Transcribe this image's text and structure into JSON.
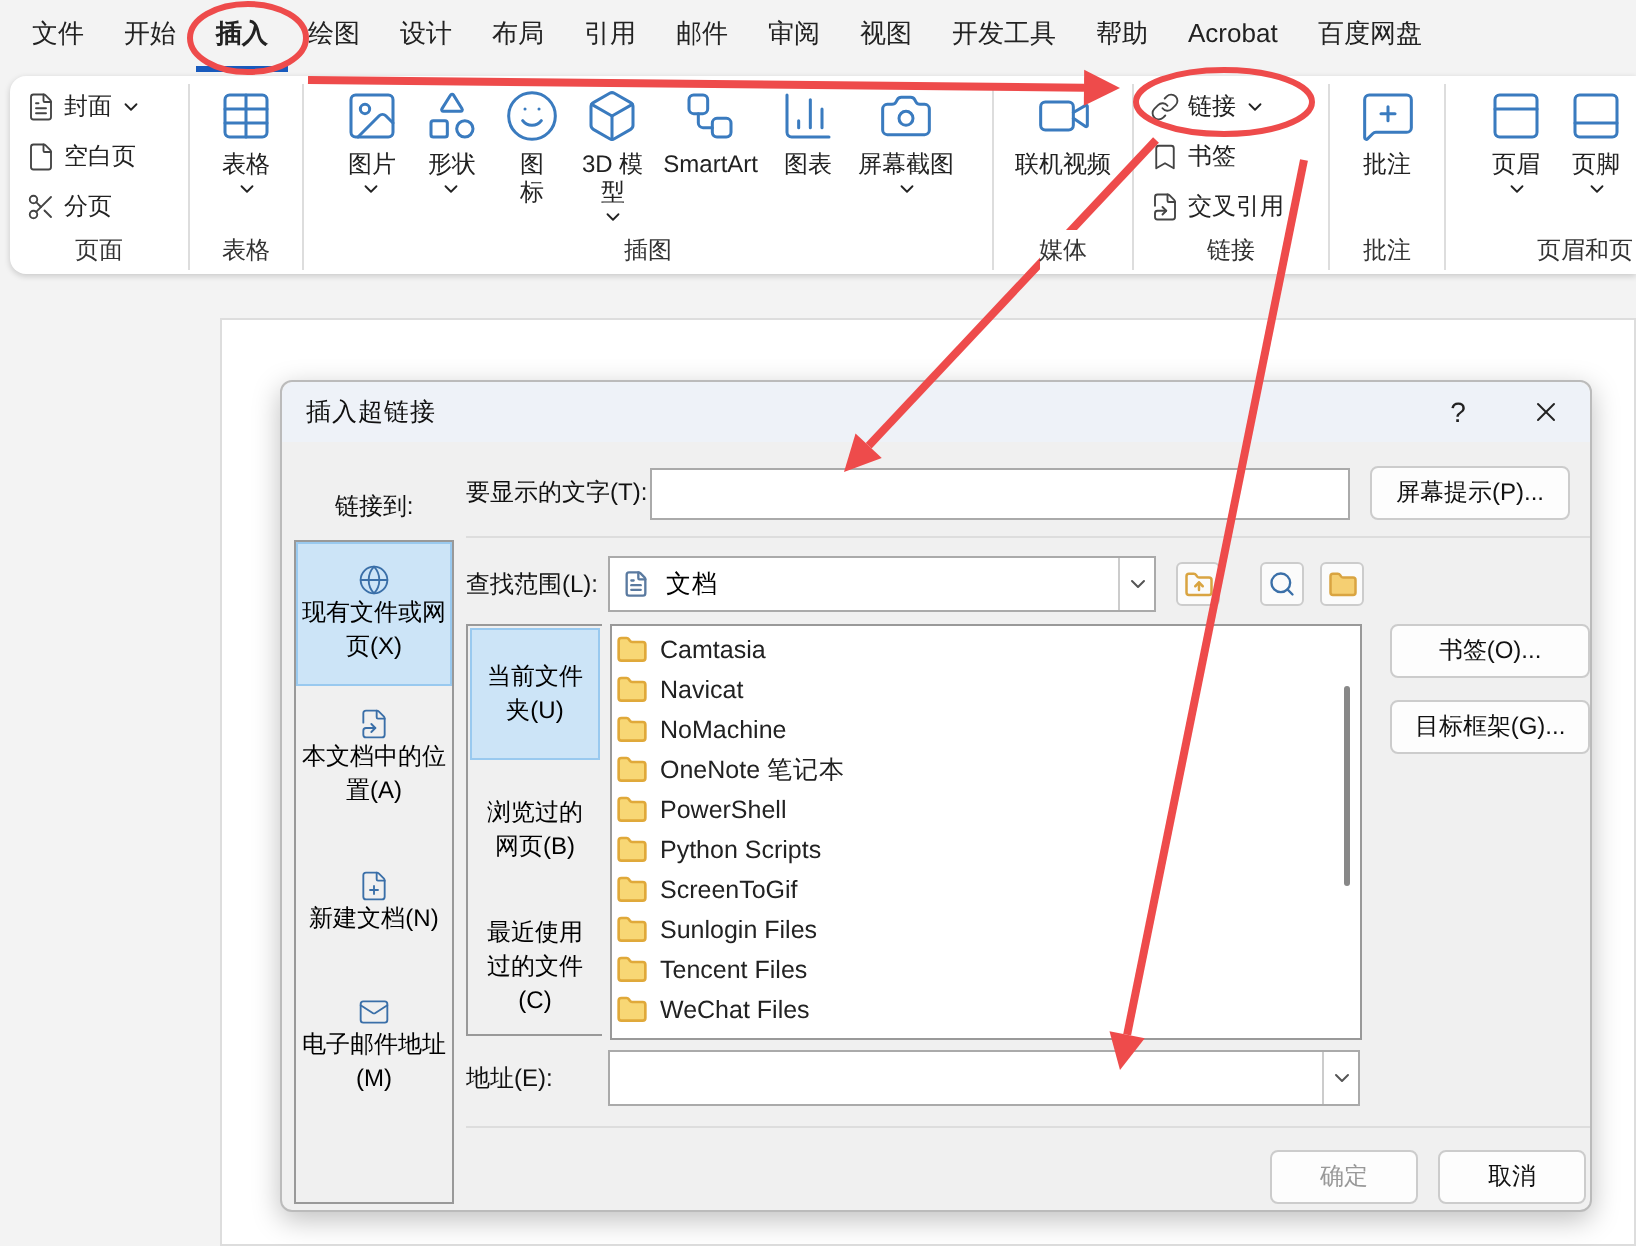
{
  "ribbon_tabs": [
    {
      "label": "文件",
      "selected": false
    },
    {
      "label": "开始",
      "selected": false
    },
    {
      "label": "插入",
      "selected": true
    },
    {
      "label": "绘图",
      "selected": false
    },
    {
      "label": "设计",
      "selected": false
    },
    {
      "label": "布局",
      "selected": false
    },
    {
      "label": "引用",
      "selected": false
    },
    {
      "label": "邮件",
      "selected": false
    },
    {
      "label": "审阅",
      "selected": false
    },
    {
      "label": "视图",
      "selected": false
    },
    {
      "label": "开发工具",
      "selected": false
    },
    {
      "label": "帮助",
      "selected": false
    },
    {
      "label": "Acrobat",
      "selected": false
    },
    {
      "label": "百度网盘",
      "selected": false
    }
  ],
  "ribbon_groups": [
    {
      "label": "页面",
      "items": [
        {
          "kind": "small",
          "lines": [
            "封面"
          ],
          "dropdown": true
        },
        {
          "kind": "small",
          "lines": [
            "空白页"
          ],
          "dropdown": false
        },
        {
          "kind": "small",
          "lines": [
            "分页"
          ],
          "dropdown": false
        }
      ]
    },
    {
      "label": "表格",
      "items": [
        {
          "kind": "large",
          "lines": [
            "表格"
          ],
          "dropdown": true
        }
      ]
    },
    {
      "label": "插图",
      "items": [
        {
          "kind": "large",
          "lines": [
            "图片"
          ],
          "dropdown": true
        },
        {
          "kind": "large",
          "lines": [
            "形状"
          ],
          "dropdown": true
        },
        {
          "kind": "large",
          "lines": [
            "图",
            "标"
          ],
          "dropdown": false
        },
        {
          "kind": "large",
          "lines": [
            "3D 模",
            "型"
          ],
          "dropdown": true
        },
        {
          "kind": "large",
          "lines": [
            "SmartArt"
          ],
          "dropdown": false
        },
        {
          "kind": "large",
          "lines": [
            "图表"
          ],
          "dropdown": false
        },
        {
          "kind": "large",
          "lines": [
            "屏幕截图"
          ],
          "dropdown": true
        }
      ]
    },
    {
      "label": "媒体",
      "items": [
        {
          "kind": "large",
          "lines": [
            "联机视频"
          ],
          "dropdown": false
        }
      ]
    },
    {
      "label": "链接",
      "items": [
        {
          "kind": "small",
          "lines": [
            "链接"
          ],
          "dropdown": true
        },
        {
          "kind": "small",
          "lines": [
            "书签"
          ],
          "dropdown": false
        },
        {
          "kind": "small",
          "lines": [
            "交叉引用"
          ],
          "dropdown": false
        }
      ]
    },
    {
      "label": "批注",
      "items": [
        {
          "kind": "large",
          "lines": [
            "批注"
          ],
          "dropdown": false
        }
      ]
    },
    {
      "label": "页眉和页",
      "items": [
        {
          "kind": "large",
          "lines": [
            "页眉"
          ],
          "dropdown": true
        },
        {
          "kind": "large",
          "lines": [
            "页脚"
          ],
          "dropdown": true
        }
      ]
    }
  ],
  "dialog": {
    "title": "插入超链接",
    "help": "?",
    "link_to_label": "链接到:",
    "link_targets": [
      {
        "label": "现有文件或网页(X)",
        "selected": true
      },
      {
        "label": "本文档中的位置(A)",
        "selected": false
      },
      {
        "label": "新建文档(N)",
        "selected": false
      },
      {
        "label": "电子邮件地址(M)",
        "selected": false
      }
    ],
    "display_text_label": "要显示的文字(T):",
    "screen_tip_button": "屏幕提示(P)...",
    "look_in": {
      "label": "查找范围(L):",
      "value": "文档"
    },
    "browse_tabs": [
      {
        "label": "当前文件夹(U)",
        "selected": true
      },
      {
        "label": "浏览过的网页(B)",
        "selected": false
      },
      {
        "label": "最近使用过的文件(C)",
        "selected": false
      }
    ],
    "files": [
      "Camtasia",
      "Navicat",
      "NoMachine",
      "OneNote 笔记本",
      "PowerShell",
      "Python Scripts",
      "ScreenToGif",
      "Sunlogin Files",
      "Tencent Files",
      "WeChat Files"
    ],
    "side_buttons": [
      "书签(O)...",
      "目标框架(G)..."
    ],
    "address_label": "地址(E):",
    "buttons": [
      {
        "label": "确定",
        "disabled": true
      },
      {
        "label": "取消",
        "disabled": false
      }
    ]
  }
}
